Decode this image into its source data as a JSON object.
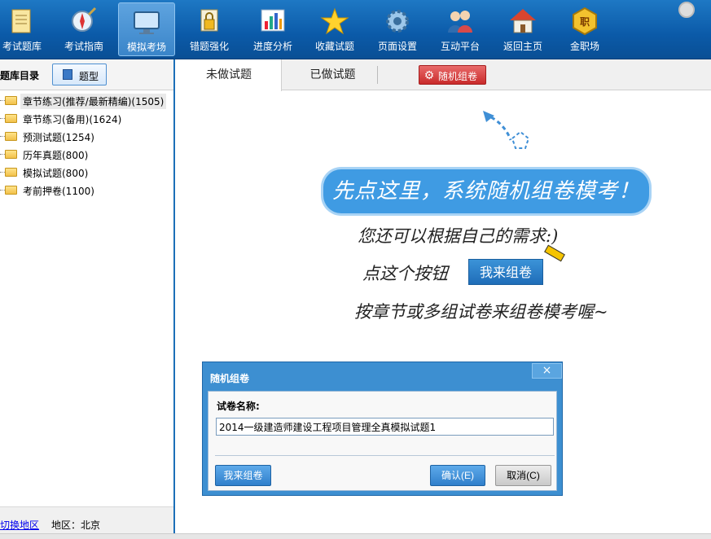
{
  "toolbar": {
    "items": [
      {
        "label": "考试题库",
        "icon": "doc-list-icon"
      },
      {
        "label": "考试指南",
        "icon": "compass-icon"
      },
      {
        "label": "模拟考场",
        "icon": "monitor-icon",
        "active": true
      },
      {
        "label": "错题强化",
        "icon": "lock-icon"
      },
      {
        "label": "进度分析",
        "icon": "bar-chart-icon"
      },
      {
        "label": "收藏试题",
        "icon": "star-icon"
      },
      {
        "label": "页面设置",
        "icon": "gear-icon"
      },
      {
        "label": "互动平台",
        "icon": "users-icon"
      },
      {
        "label": "返回主页",
        "icon": "home-icon"
      },
      {
        "label": "金职场",
        "icon": "badge-icon"
      }
    ]
  },
  "sidebar": {
    "title": "题库目录",
    "type_button": "题型",
    "items": [
      {
        "label": "章节练习(推荐/最新精编)(1505)"
      },
      {
        "label": "章节练习(备用)(1624)"
      },
      {
        "label": "预测试题(1254)"
      },
      {
        "label": "历年真题(800)"
      },
      {
        "label": "模拟试题(800)"
      },
      {
        "label": "考前押卷(1100)"
      }
    ],
    "switch_region": "切换地区",
    "region": "地区：北京"
  },
  "tabs": {
    "undone": "未做试题",
    "done": "已做试题",
    "random": "随机组卷"
  },
  "hint": {
    "headline": "先点这里，系统随机组卷模考！",
    "line1": "您还可以根据自己的需求:)",
    "line2": "点这个按钮",
    "button": "我来组卷",
    "line3": "按章节或多组试卷来组卷模考喔~"
  },
  "dialog": {
    "title": "随机组卷",
    "close": "×",
    "label": "试卷名称:",
    "value": "2014一级建造师建设工程项目管理全真模拟试题1",
    "custom": "我来组卷",
    "ok": "确认(E)",
    "cancel": "取消(C)"
  },
  "colors": {
    "toolbar": "#0b5aa8",
    "accent": "#3d8fd1",
    "random_button": "#c92b2b"
  }
}
